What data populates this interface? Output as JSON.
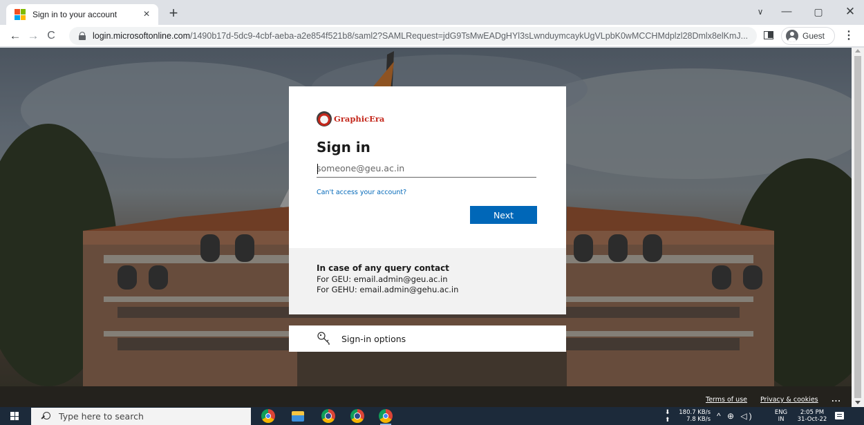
{
  "browser": {
    "tab_title": "Sign in to your account",
    "tab_close": "×",
    "new_tab": "+",
    "url_domain": "login.microsoftonline.com",
    "url_path": "/1490b17d-5dc9-4cbf-aeba-a2e854f521b8/saml2?SAMLRequest=jdG9TsMwEADgHYl3sLwnduymcaykUgVLpbK0wMCCHMdplzl28Dmlx8elKmJ...",
    "profile_label": "Guest",
    "window_controls": {
      "list": "∨",
      "minimize": "—",
      "maximize": "▢",
      "close": "✕"
    },
    "nav": {
      "back": "←",
      "forward": "→",
      "reload": "C"
    }
  },
  "signin": {
    "logo_text": "GraphicEra",
    "title": "Sign in",
    "email_placeholder": "someone@geu.ac.in",
    "email_value": "",
    "cant_access_link": "Can't access your account?",
    "next_button": "Next",
    "contact_heading": "In case of any query contact",
    "contact_geu": "For GEU: email.admin@geu.ac.in",
    "contact_gehu": "For GEHU: email.admin@gehu.ac.in",
    "options_label": "Sign-in options",
    "icons": {
      "key": "key-icon"
    }
  },
  "page_footer": {
    "terms": "Terms of use",
    "privacy": "Privacy & cookies",
    "more": "..."
  },
  "taskbar": {
    "search_placeholder": "Type here to search",
    "net_down": "180.7 KB/s",
    "net_up": "7.8 KB/s",
    "lang_line1": "ENG",
    "lang_line2": "IN",
    "time": "2:05 PM",
    "date": "31-Oct-22"
  },
  "colors": {
    "accent": "#0067b8",
    "next_button_text": "#ffffff",
    "footer_panel": "#f2f2f2",
    "taskbar": "#1c2a3a",
    "ms_logo": [
      "#f25022",
      "#7fba00",
      "#00a4ef",
      "#ffb900"
    ]
  }
}
